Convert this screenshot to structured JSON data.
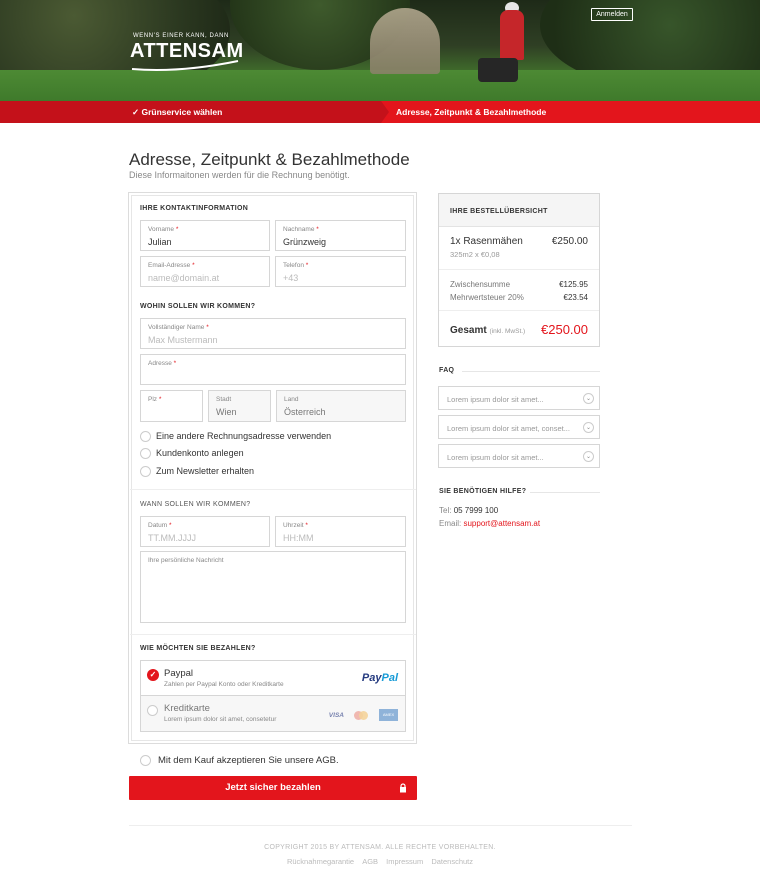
{
  "header": {
    "tagline": "WENN'S EINER KANN, DANN",
    "logo": "ATTENSAM",
    "login_label": "Anmelden"
  },
  "steps": [
    {
      "label": "✓  Grünservice wählen"
    },
    {
      "label": "Adresse, Zeitpunkt & Bezahlmethode"
    }
  ],
  "page": {
    "title": "Adresse, Zeitpunkt & Bezahlmethode",
    "subtitle": "Diese Informaitonen werden für die Rechnung benötigt."
  },
  "contact": {
    "section_label": "IHRE KONTAKTINFORMATION",
    "first_name": {
      "label": "Vorname",
      "value": "Julian"
    },
    "last_name": {
      "label": "Nachname",
      "value": "Grünzweig"
    },
    "email": {
      "label": "Email-Adresse",
      "placeholder": "name@domain.at"
    },
    "phone": {
      "label": "Telefon",
      "placeholder": "+43"
    }
  },
  "address": {
    "section_label": "WOHIN SOLLEN WIR KOMMEN?",
    "full_name": {
      "label": "Vollständiger Name",
      "placeholder": "Max Mustermann"
    },
    "street": {
      "label": "Adresse"
    },
    "zip": {
      "label": "Plz"
    },
    "city": {
      "label": "Stadt",
      "value": "Wien"
    },
    "country": {
      "label": "Land",
      "value": "Österreich"
    },
    "options": [
      {
        "label": "Eine andere Rechnungsadresse verwenden"
      },
      {
        "label": "Kundenkonto anlegen"
      },
      {
        "label": "Zum Newsletter erhalten"
      }
    ]
  },
  "schedule": {
    "section_label": "WANN SOLLEN WIR KOMMEN?",
    "date": {
      "label": "Datum",
      "placeholder": "TT.MM.JJJJ"
    },
    "time": {
      "label": "Uhrzeit",
      "placeholder": "HH:MM"
    },
    "message": {
      "label": "Ihre persönliche Nachricht"
    }
  },
  "payment": {
    "section_label": "WIE MÖCHTEN SIE BEZAHLEN?",
    "paypal": {
      "title": "Paypal",
      "desc": "Zahlen per Paypal Konto oder Kreditkarte",
      "logo_a": "Pay",
      "logo_b": "Pal",
      "selected": true
    },
    "card": {
      "title": "Kreditkarte",
      "desc": "Lorem ipsum dolor sit amet, consetetur",
      "visa": "VISA",
      "amex": "AMEX",
      "selected": false
    }
  },
  "agb_label": "Mit dem Kauf akzeptieren Sie unsere AGB.",
  "submit_label": "Jetzt sicher bezahlen",
  "summary": {
    "title": "IHRE BESTELLÜBERSICHT",
    "item": "1x Rasenmähen",
    "item_price": "€250.00",
    "item_detail": "325m2 x €0,08",
    "subtotal_label": "Zwischensumme",
    "subtotal": "€125.95",
    "tax_label": "Mehrwertsteuer 20%",
    "tax": "€23.54",
    "total_label": "Gesamt",
    "total_note": "(inkl. MwSt.)",
    "total": "€250.00"
  },
  "faq": {
    "title": "FAQ",
    "items": [
      {
        "q": "Lorem ipsum dolor sit amet..."
      },
      {
        "q": "Lorem ipsum dolor sit amet, conset..."
      },
      {
        "q": "Lorem ipsum dolor sit amet..."
      }
    ]
  },
  "help": {
    "title": "SIE BENÖTIGEN HILFE?",
    "tel_label": "Tel:",
    "tel": "05 7999 100",
    "email_label": "Email:",
    "email": "support@attensam.at"
  },
  "footer": {
    "copyright": "COPYRIGHT 2015 BY ATTENSAM. ALLE RECHTE VORBEHALTEN.",
    "links": [
      "Rücknahmegarantie",
      "AGB",
      "Impressum",
      "Datenschutz"
    ]
  },
  "colors": {
    "accent": "#e3151c",
    "accent_dark": "#c4111a"
  }
}
